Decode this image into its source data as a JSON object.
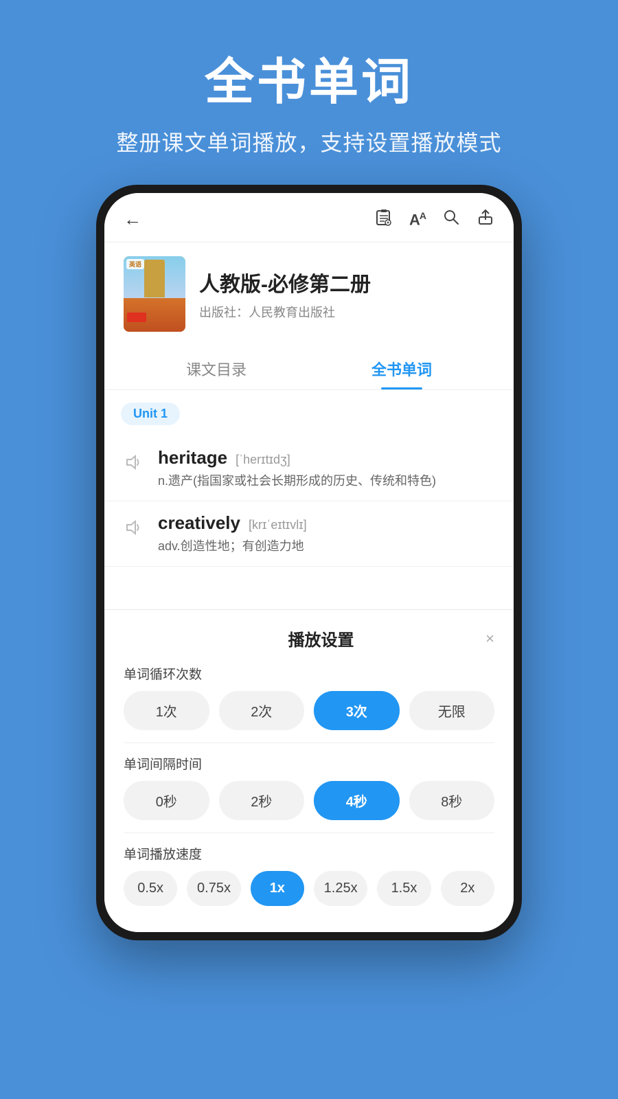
{
  "banner": {
    "title": "全书单词",
    "subtitle": "整册课文单词播放，支持设置播放模式"
  },
  "phone": {
    "topbar": {
      "back_icon": "←",
      "icon1": "📋",
      "icon2": "Aa",
      "icon3": "🔍",
      "icon4": "↑"
    },
    "book": {
      "title": "人教版-必修第二册",
      "publisher": "出版社：人民教育出版社"
    },
    "tabs": [
      {
        "label": "课文目录",
        "active": false
      },
      {
        "label": "全书单词",
        "active": true
      }
    ],
    "unit_badge": "Unit 1",
    "words": [
      {
        "en": "heritage",
        "phonetic": "[ˈherɪtɪdʒ]",
        "cn": "n.遗产(指国家或社会长期形成的历史、传统和特色)"
      },
      {
        "en": "creatively",
        "phonetic": "[krɪˈeɪtɪvlɪ]",
        "cn": "adv.创造性地；有创造力地"
      }
    ],
    "settings": {
      "title": "播放设置",
      "close_icon": "×",
      "sections": [
        {
          "label": "单词循环次数",
          "options": [
            "1次",
            "2次",
            "3次",
            "无限"
          ],
          "active_index": 2
        },
        {
          "label": "单词间隔时间",
          "options": [
            "0秒",
            "2秒",
            "4秒",
            "8秒"
          ],
          "active_index": 2
        },
        {
          "label": "单词播放速度",
          "options": [
            "0.5x",
            "0.75x",
            "1x",
            "1.25x",
            "1.5x",
            "2x"
          ],
          "active_index": 2
        }
      ]
    }
  }
}
